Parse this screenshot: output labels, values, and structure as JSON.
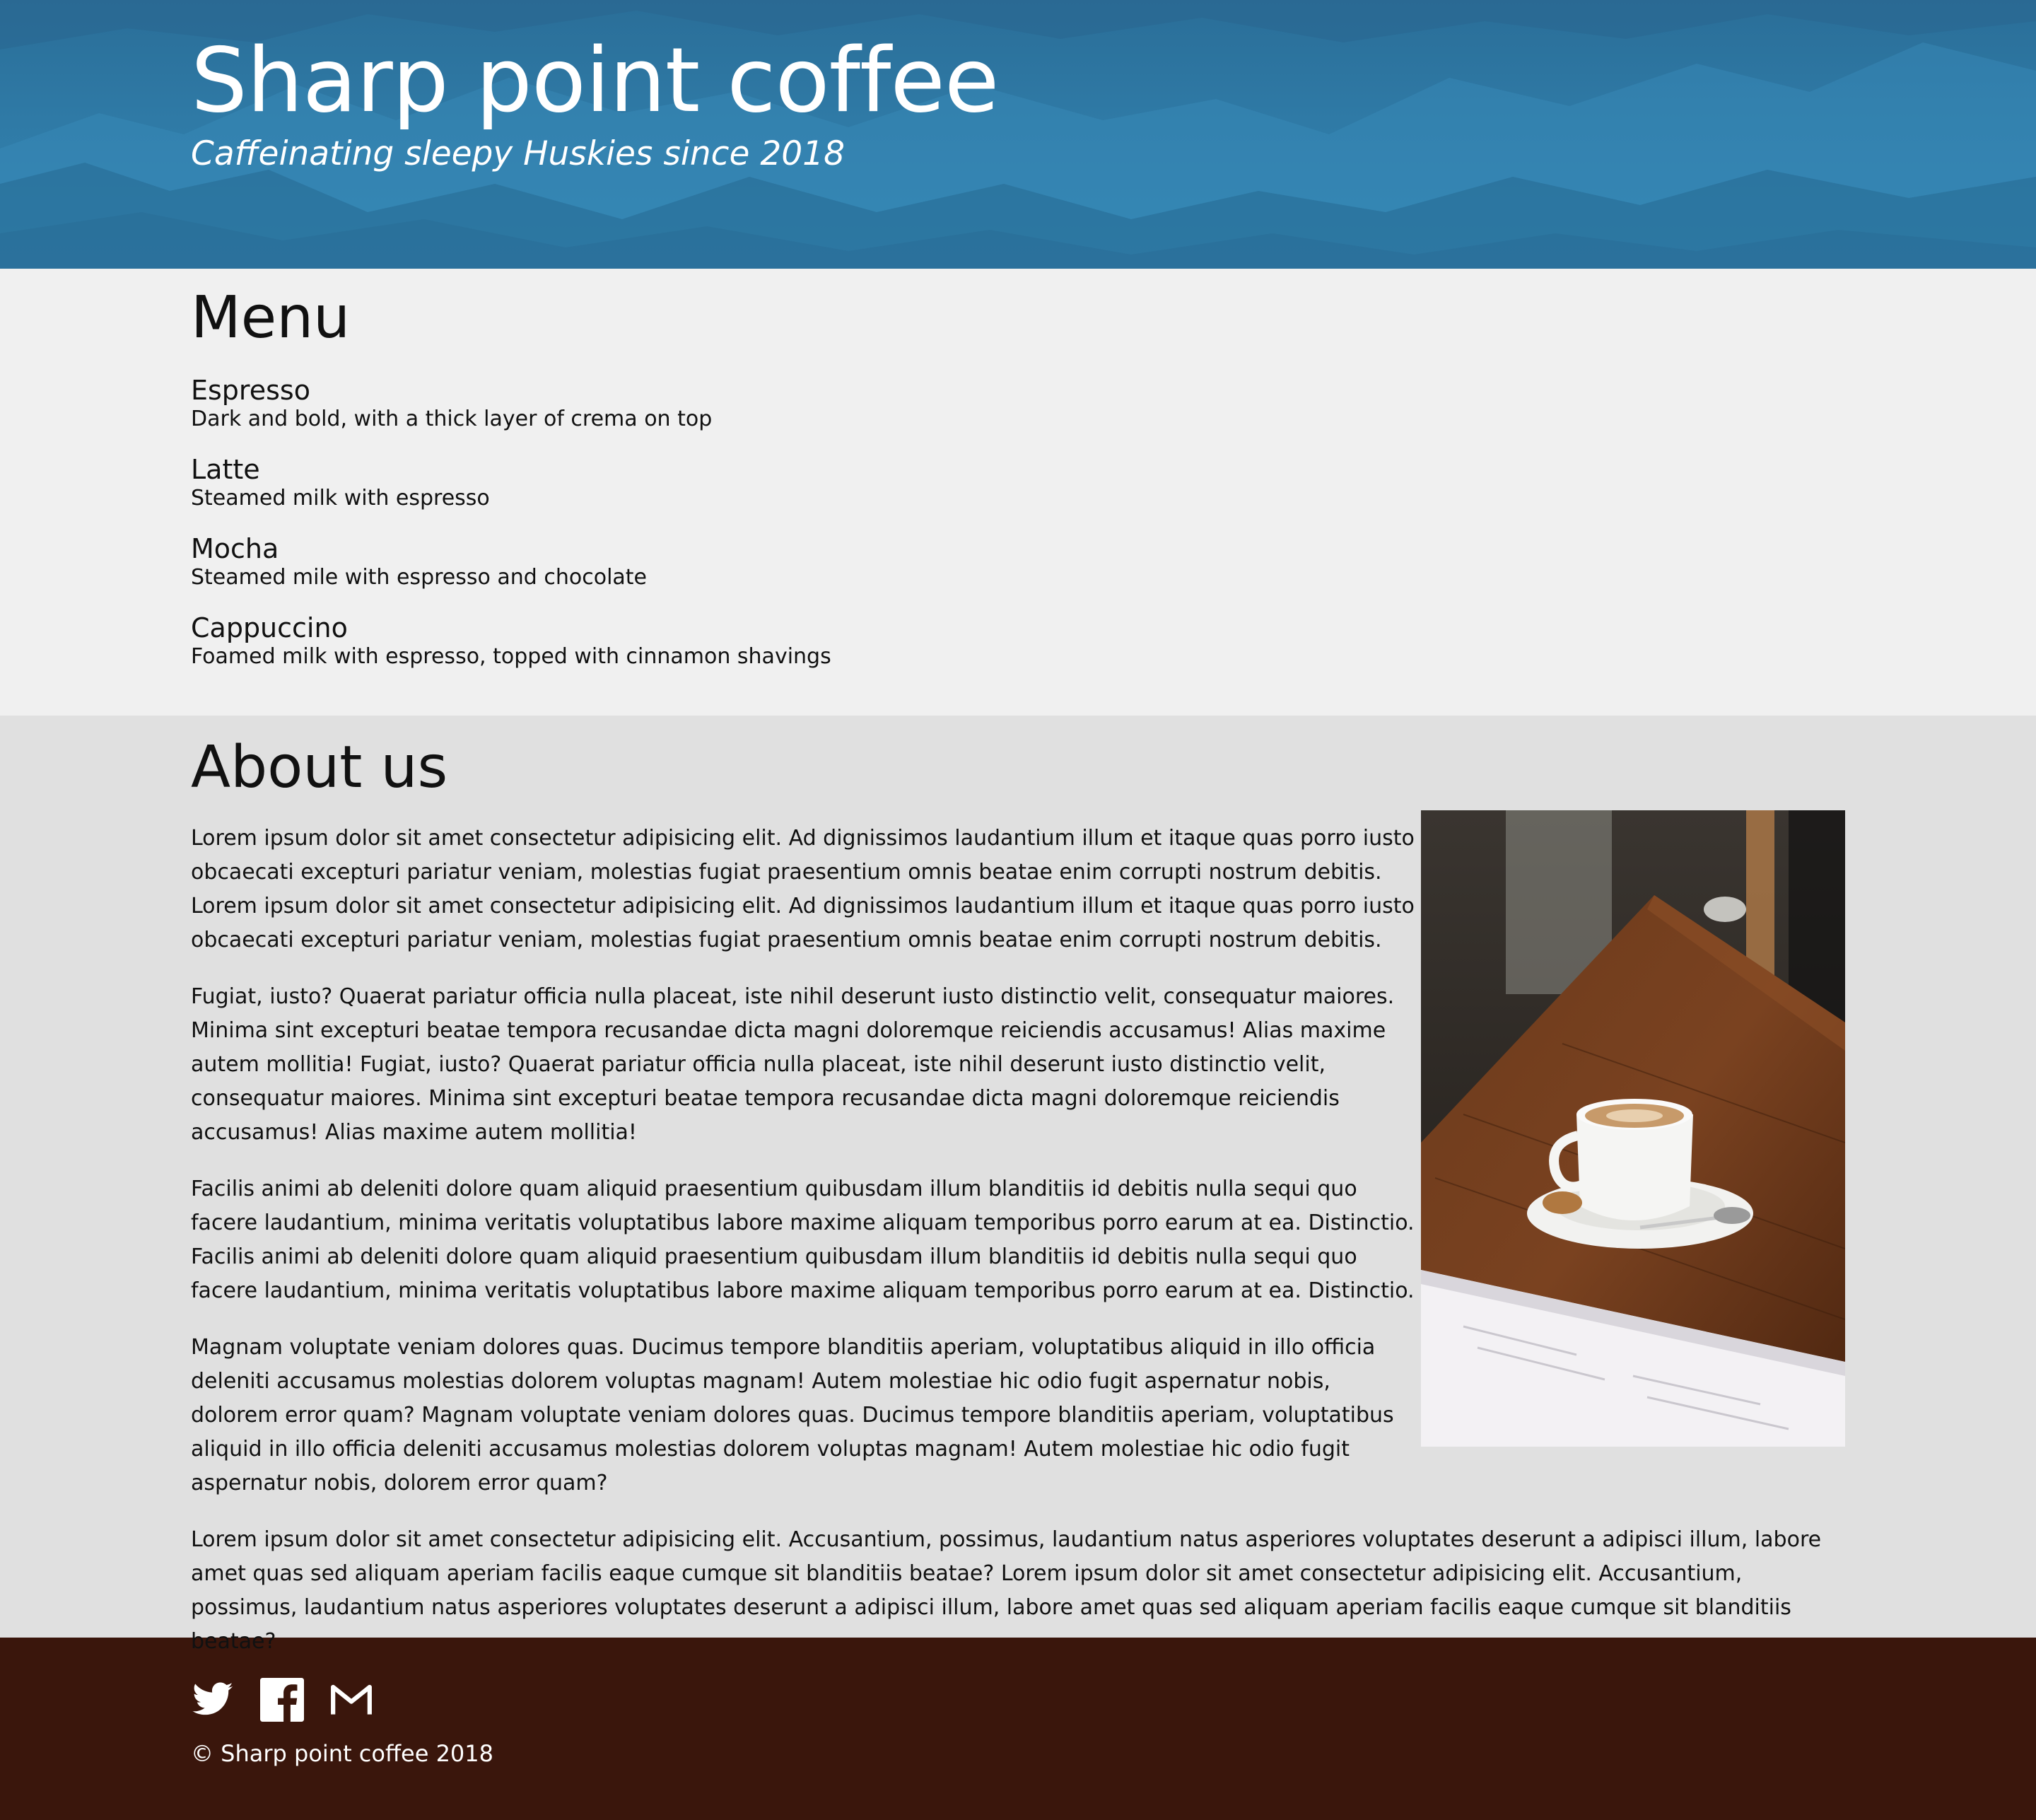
{
  "header": {
    "title": "Sharp point coffee",
    "tagline": "Caffeinating sleepy Huskies since 2018"
  },
  "menu": {
    "title": "Menu",
    "items": [
      {
        "name": "Espresso",
        "description": "Dark and bold, with a thick layer of crema on top"
      },
      {
        "name": "Latte",
        "description": "Steamed milk with espresso"
      },
      {
        "name": "Mocha",
        "description": "Steamed mile with espresso and chocolate"
      },
      {
        "name": "Cappuccino",
        "description": "Foamed milk with espresso, topped with cinnamon shavings"
      }
    ]
  },
  "about": {
    "title": "About us",
    "paragraphs": [
      "Lorem ipsum dolor sit amet consectetur adipisicing elit. Ad dignissimos laudantium illum et itaque quas porro iusto obcaecati excepturi pariatur veniam, molestias fugiat praesentium omnis beatae enim corrupti nostrum debitis. Lorem ipsum dolor sit amet consectetur adipisicing elit. Ad dignissimos laudantium illum et itaque quas porro iusto obcaecati excepturi pariatur veniam, molestias fugiat praesentium omnis beatae enim corrupti nostrum debitis.",
      "Fugiat, iusto? Quaerat pariatur officia nulla placeat, iste nihil deserunt iusto distinctio velit, consequatur maiores. Minima sint excepturi beatae tempora recusandae dicta magni doloremque reiciendis accusamus! Alias maxime autem mollitia! Fugiat, iusto? Quaerat pariatur officia nulla placeat, iste nihil deserunt iusto distinctio velit, consequatur maiores. Minima sint excepturi beatae tempora recusandae dicta magni doloremque reiciendis accusamus! Alias maxime autem mollitia!",
      "Facilis animi ab deleniti dolore quam aliquid praesentium quibusdam illum blanditiis id debitis nulla sequi quo facere laudantium, minima veritatis voluptatibus labore maxime aliquam temporibus porro earum at ea. Distinctio. Facilis animi ab deleniti dolore quam aliquid praesentium quibusdam illum blanditiis id debitis nulla sequi quo facere laudantium, minima veritatis voluptatibus labore maxime aliquam temporibus porro earum at ea. Distinctio.",
      "Magnam voluptate veniam dolores quas. Ducimus tempore blanditiis aperiam, voluptatibus aliquid in illo officia deleniti accusamus molestias dolorem voluptas magnam! Autem molestiae hic odio fugit aspernatur nobis, dolorem error quam? Magnam voluptate veniam dolores quas. Ducimus tempore blanditiis aperiam, voluptatibus aliquid in illo officia deleniti accusamus molestias dolorem voluptas magnam! Autem molestiae hic odio fugit aspernatur nobis, dolorem error quam?",
      "Lorem ipsum dolor sit amet consectetur adipisicing elit. Accusantium, possimus, laudantium natus asperiores voluptates deserunt a adipisci illum, labore amet quas sed aliquam aperiam facilis eaque cumque sit blanditiis beatae? Lorem ipsum dolor sit amet consectetur adipisicing elit. Accusantium, possimus, laudantium natus asperiores voluptates deserunt a adipisci illum, labore amet quas sed aliquam aperiam facilis eaque cumque sit blanditiis beatae?"
    ]
  },
  "footer": {
    "social": [
      {
        "icon": "twitter-icon"
      },
      {
        "icon": "facebook-icon"
      },
      {
        "icon": "gmail-icon"
      }
    ],
    "copyright": "© Sharp point coffee 2018"
  },
  "colors": {
    "header_blue": "#2f7aa6",
    "menu_background": "#f0f0f0",
    "about_background": "#e0e0e0",
    "footer_brown": "#3a160c",
    "text": "#111111"
  }
}
